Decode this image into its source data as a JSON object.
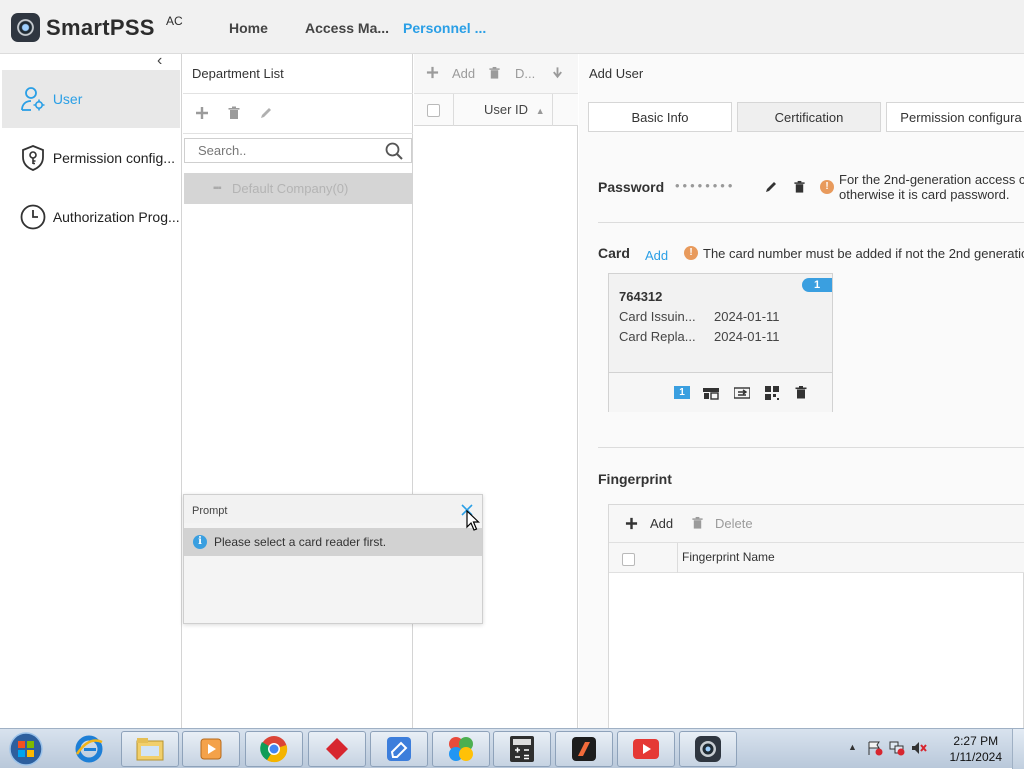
{
  "app": {
    "name": "SmartPSS",
    "name_sup": "AC"
  },
  "nav": {
    "tabs": [
      {
        "label": "Home"
      },
      {
        "label": "Access Ma..."
      },
      {
        "label": "Personnel ..."
      }
    ],
    "active_index": 2
  },
  "sidebar": {
    "items": [
      {
        "label": "User",
        "icon": "user-gear-icon",
        "active": true
      },
      {
        "label": "Permission config...",
        "icon": "shield-key-icon"
      },
      {
        "label": "Authorization Prog...",
        "icon": "clock-icon"
      }
    ]
  },
  "department": {
    "title": "Department List",
    "search_placeholder": "Search..",
    "tree": [
      {
        "label": "Default Company(0)"
      }
    ]
  },
  "user_list": {
    "toolbar": {
      "add": "Add",
      "delete": "D..."
    },
    "columns": [
      {
        "label": "User ID",
        "sort": "asc"
      }
    ]
  },
  "add_user": {
    "title": "Add User",
    "tabs": [
      {
        "label": "Basic Info"
      },
      {
        "label": "Certification",
        "active": true
      },
      {
        "label": "Permission configura"
      }
    ],
    "password": {
      "label": "Password",
      "masked": "••••••••",
      "note_line1": "For the 2nd-generation access c",
      "note_line2": "otherwise it is card password."
    },
    "card": {
      "label": "Card",
      "add_link": "Add",
      "note": "The card number must be added if not the 2nd generatio",
      "items": [
        {
          "number": "764312",
          "badge": "1",
          "fields": [
            {
              "key": "Card Issuin...",
              "value": "2024-01-11"
            },
            {
              "key": "Card Repla...",
              "value": "2024-01-11"
            }
          ],
          "action_badge": "1"
        }
      ]
    },
    "fingerprint": {
      "label": "Fingerprint",
      "add": "Add",
      "delete": "Delete",
      "columns": [
        {
          "label": "Fingerprint Name"
        }
      ]
    }
  },
  "prompt": {
    "title": "Prompt",
    "message": "Please select a card reader first."
  },
  "taskbar": {
    "apps": [
      {
        "name": "internet-explorer-icon"
      },
      {
        "name": "file-explorer-icon"
      },
      {
        "name": "media-player-icon"
      },
      {
        "name": "chrome-icon"
      },
      {
        "name": "red-diamond-app-icon"
      },
      {
        "name": "eraser-app-icon"
      },
      {
        "name": "colorful-app-icon"
      },
      {
        "name": "calculator-icon"
      },
      {
        "name": "orange-app-icon"
      },
      {
        "name": "video-player-icon"
      },
      {
        "name": "smartpss-icon"
      }
    ],
    "clock": {
      "time": "2:27 PM",
      "date": "1/11/2024"
    }
  },
  "colors": {
    "accent": "#2a9fe6",
    "warning": "#e89a5c",
    "badge": "#3a9fe0"
  }
}
